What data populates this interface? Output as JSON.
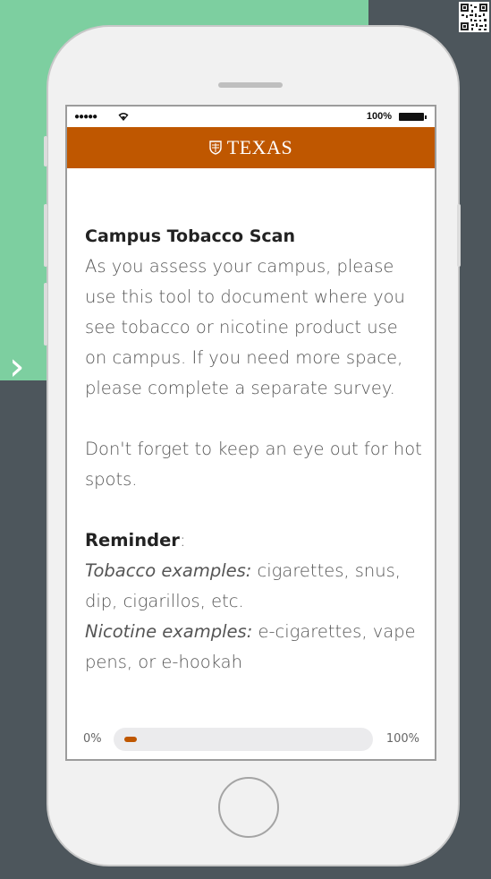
{
  "nav": {
    "next_icon": "chevron-right-icon"
  },
  "status_bar": {
    "signal": "●●●●●",
    "battery_percent": "100%"
  },
  "header": {
    "brand": "TEXAS",
    "logo": "ut-shield-icon",
    "background": "#bf5700"
  },
  "content": {
    "heading": "Campus Tobacco Scan",
    "intro": "As you assess your campus, please use this tool to document where you see tobacco or nicotine product use on campus. If you need more space, please complete a separate survey.",
    "hot_spots": "Don't forget to keep an eye out for hot spots.",
    "reminder_label": "Reminder",
    "reminder_colon": ":",
    "tobacco_label": "Tobacco examples:",
    "tobacco_text": " cigarettes, snus, dip, cigarillos, etc.",
    "nicotine_label": "Nicotine examples:",
    "nicotine_text": " e-cigarettes, vape pens, or e-hookah"
  },
  "progress": {
    "min_label": "0%",
    "max_label": "100%",
    "value_percent": 0
  },
  "colors": {
    "accent": "#bf5700",
    "panel_green": "#7dcfa0",
    "background": "#4d565c"
  }
}
